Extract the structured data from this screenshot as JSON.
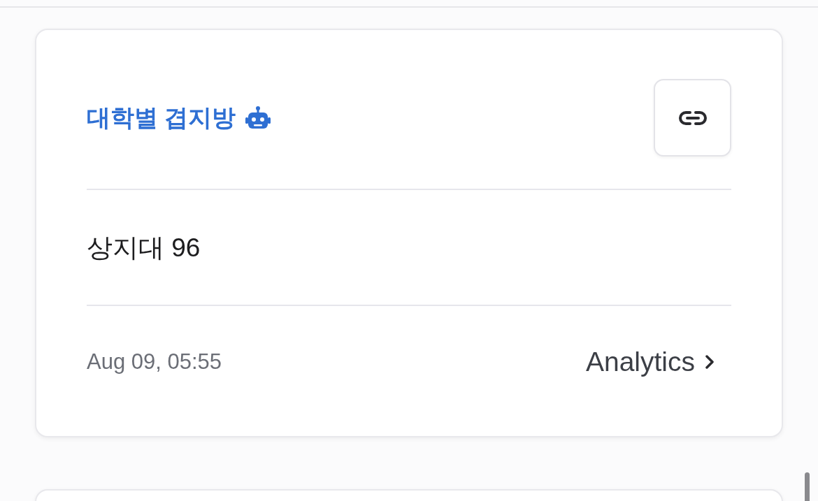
{
  "card": {
    "title": "대학별 겹지방",
    "message": "상지대 96",
    "timestamp": "Aug 09, 05:55",
    "analytics_link": "Analytics"
  }
}
